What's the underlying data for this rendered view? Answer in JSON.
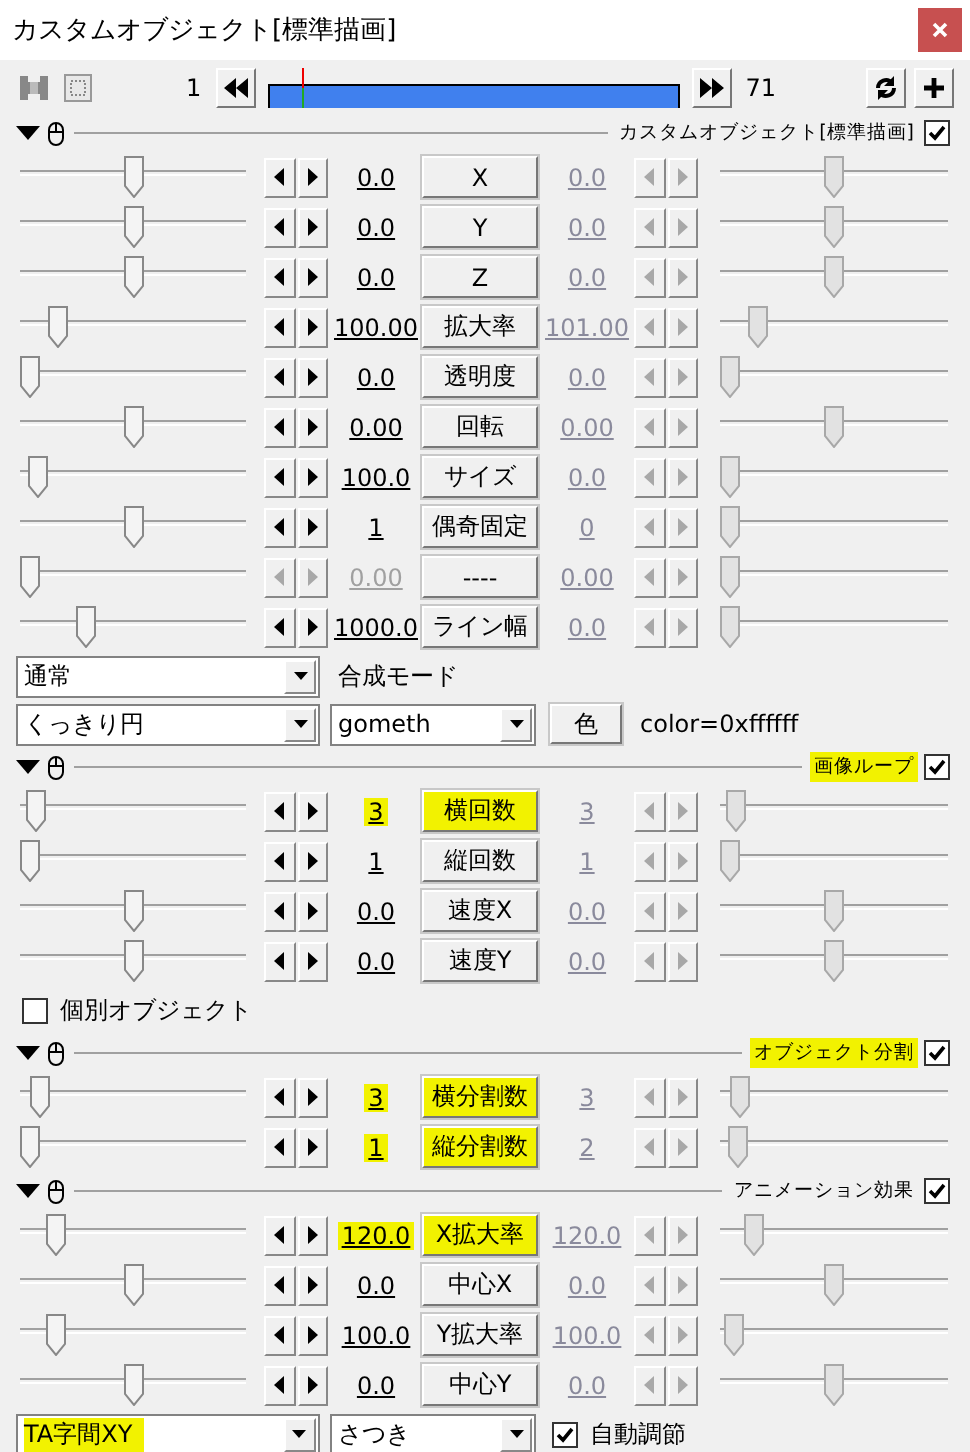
{
  "window": {
    "title": "カスタムオブジェクト[標準描画]"
  },
  "toolbar": {
    "start_frame": "1",
    "end_frame": "71",
    "timeline": {
      "level": 0.083
    }
  },
  "blocks": [
    {
      "kind": "section",
      "header": {
        "label": "カスタムオブジェクト[標準描画]",
        "checked": true,
        "highlighted": false
      },
      "rows": [
        {
          "name": "X",
          "value": "0.0",
          "end_value": "0.0",
          "left_slider": {
            "level": 0.5
          },
          "right_slider": {
            "level": 0.5
          },
          "disabled": false,
          "highlighted": false
        },
        {
          "name": "Y",
          "value": "0.0",
          "end_value": "0.0",
          "left_slider": {
            "level": 0.5
          },
          "right_slider": {
            "level": 0.5
          },
          "disabled": false,
          "highlighted": false
        },
        {
          "name": "Z",
          "value": "0.0",
          "end_value": "0.0",
          "left_slider": {
            "level": 0.5
          },
          "right_slider": {
            "level": 0.5
          },
          "disabled": false,
          "highlighted": false
        },
        {
          "name": "拡大率",
          "value": "100.00",
          "end_value": "101.00",
          "left_slider": {
            "level": 0.14
          },
          "right_slider": {
            "level": 0.13
          },
          "disabled": false,
          "highlighted": false
        },
        {
          "name": "透明度",
          "value": "0.0",
          "end_value": "0.0",
          "left_slider": {
            "level": 0
          },
          "right_slider": {
            "level": 0
          },
          "disabled": false,
          "highlighted": false
        },
        {
          "name": "回転",
          "value": "0.00",
          "end_value": "0.00",
          "left_slider": {
            "level": 0.5
          },
          "right_slider": {
            "level": 0.5
          },
          "disabled": false,
          "highlighted": false
        },
        {
          "name": "サイズ",
          "value": "100.0",
          "end_value": "0.0",
          "left_slider": {
            "level": 0.04
          },
          "right_slider": {
            "level": 0
          },
          "disabled": false,
          "highlighted": false
        },
        {
          "name": "偶奇固定",
          "value": "1",
          "end_value": "0",
          "left_slider": {
            "level": 0.5
          },
          "right_slider": {
            "level": 0
          },
          "disabled": false,
          "highlighted": false
        },
        {
          "name": "----",
          "value": "0.00",
          "end_value": "0.00",
          "left_slider": {
            "level": 0
          },
          "right_slider": {
            "level": 0
          },
          "disabled": true,
          "highlighted": false
        },
        {
          "name": "ライン幅",
          "value": "1000.0",
          "end_value": "0.0",
          "left_slider": {
            "level": 0.27
          },
          "right_slider": {
            "level": 0
          },
          "disabled": false,
          "highlighted": false
        }
      ]
    },
    {
      "kind": "controls",
      "items": [
        {
          "kind": "select",
          "value": "通常",
          "highlighted": false
        },
        {
          "kind": "label",
          "text": "合成モード"
        }
      ]
    },
    {
      "kind": "controls",
      "items": [
        {
          "kind": "select",
          "value": "くっきり円",
          "highlighted": false
        },
        {
          "kind": "select",
          "value": "gometh",
          "highlighted": false
        },
        {
          "kind": "button",
          "text": "色"
        },
        {
          "kind": "label",
          "text": "color=0xffffff"
        }
      ]
    },
    {
      "kind": "section",
      "header": {
        "label": "画像ループ",
        "checked": true,
        "highlighted": true
      },
      "rows": [
        {
          "name": "横回数",
          "value": "3",
          "end_value": "3",
          "left_slider": {
            "level": 0.03
          },
          "right_slider": {
            "level": 0.03
          },
          "disabled": false,
          "highlighted": true
        },
        {
          "name": "縦回数",
          "value": "1",
          "end_value": "1",
          "left_slider": {
            "level": 0
          },
          "right_slider": {
            "level": 0
          },
          "disabled": false,
          "highlighted": false
        },
        {
          "name": "速度X",
          "value": "0.0",
          "end_value": "0.0",
          "left_slider": {
            "level": 0.5
          },
          "right_slider": {
            "level": 0.5
          },
          "disabled": false,
          "highlighted": false
        },
        {
          "name": "速度Y",
          "value": "0.0",
          "end_value": "0.0",
          "left_slider": {
            "level": 0.5
          },
          "right_slider": {
            "level": 0.5
          },
          "disabled": false,
          "highlighted": false
        }
      ]
    },
    {
      "kind": "controls",
      "items": [
        {
          "kind": "checkbox",
          "text": "個別オブジェクト",
          "checked": false
        }
      ]
    },
    {
      "kind": "section",
      "header": {
        "label": "オブジェクト分割",
        "checked": true,
        "highlighted": true
      },
      "rows": [
        {
          "name": "横分割数",
          "value": "3",
          "end_value": "3",
          "left_slider": {
            "level": 0.05
          },
          "right_slider": {
            "level": 0.05
          },
          "disabled": false,
          "highlighted": true
        },
        {
          "name": "縦分割数",
          "value": "1",
          "end_value": "2",
          "left_slider": {
            "level": 0
          },
          "right_slider": {
            "level": 0.04
          },
          "disabled": false,
          "highlighted": true
        }
      ]
    },
    {
      "kind": "section",
      "header": {
        "label": "アニメーション効果",
        "checked": true,
        "highlighted": false
      },
      "rows": [
        {
          "name": "X拡大率",
          "value": "120.0",
          "end_value": "120.0",
          "left_slider": {
            "level": 0.13
          },
          "right_slider": {
            "level": 0.12
          },
          "disabled": false,
          "highlighted": true
        },
        {
          "name": "中心X",
          "value": "0.0",
          "end_value": "0.0",
          "left_slider": {
            "level": 0.5
          },
          "right_slider": {
            "level": 0.5
          },
          "disabled": false,
          "highlighted": false
        },
        {
          "name": "Y拡大率",
          "value": "100.0",
          "end_value": "100.0",
          "left_slider": {
            "level": 0.13
          },
          "right_slider": {
            "level": 0.02
          },
          "disabled": false,
          "highlighted": false
        },
        {
          "name": "中心Y",
          "value": "0.0",
          "end_value": "0.0",
          "left_slider": {
            "level": 0.5
          },
          "right_slider": {
            "level": 0.5
          },
          "disabled": false,
          "highlighted": false
        }
      ]
    },
    {
      "kind": "controls",
      "items": [
        {
          "kind": "select",
          "value": "TA字間XY",
          "highlighted": true
        },
        {
          "kind": "select",
          "value": "さつき",
          "highlighted": false
        },
        {
          "kind": "checkbox",
          "text": "自動調節",
          "checked": true
        }
      ]
    }
  ]
}
